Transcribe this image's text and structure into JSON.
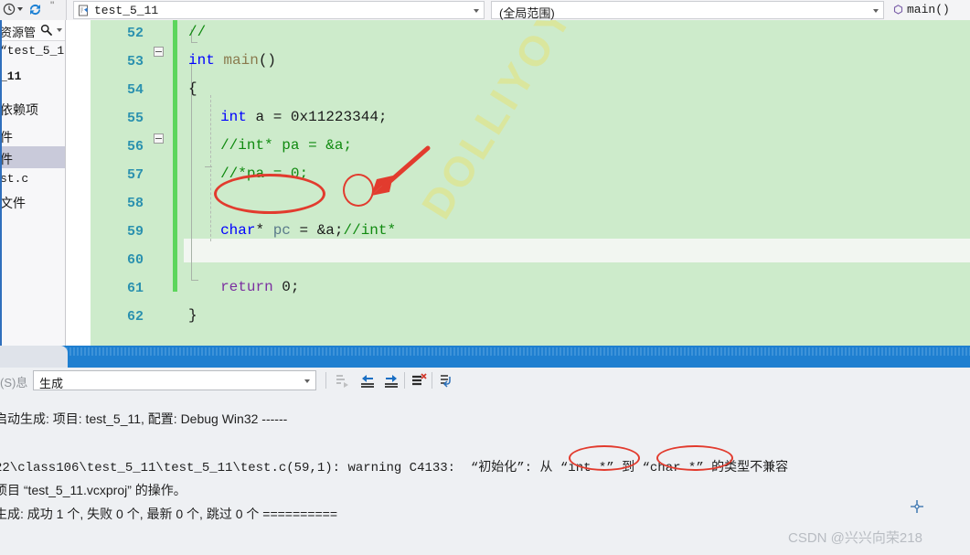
{
  "topbar": {
    "clock_icon": "clock-icon",
    "refresh_icon": "refresh-icon",
    "stray_quote": "\"",
    "file_combo": {
      "value": "test_5_11",
      "icon": "file-c-icon"
    },
    "scope_combo": {
      "value": "(全局范围)"
    },
    "member_combo": {
      "value": "main()",
      "icon": "method-icon"
    }
  },
  "solution_explorer": {
    "search_label": "资源管",
    "search_icon": "search-icon",
    "dropdown_icon": "chevron-down-icon",
    "items": [
      {
        "label": "“test_5_1",
        "style": "mono"
      },
      {
        "label": "_11",
        "style": "bold"
      },
      {
        "label": "依赖项",
        "style": "normal"
      },
      {
        "label": "件",
        "style": "normal"
      },
      {
        "label": "件",
        "style": "normal",
        "selected": true
      },
      {
        "label": "st.c",
        "style": "mono"
      },
      {
        "label": "文件",
        "style": "normal"
      }
    ]
  },
  "editor": {
    "watermark": "DOLLIYOY",
    "lines": [
      {
        "number": "52",
        "indent": 0,
        "tokens": [
          {
            "t": "//",
            "c": "cmt"
          }
        ]
      },
      {
        "number": "53",
        "indent": 0,
        "tokens": [
          {
            "t": "int",
            "c": "kw"
          },
          {
            "t": " ",
            "c": "num"
          },
          {
            "t": "main",
            "c": "fn"
          },
          {
            "t": "()",
            "c": "num"
          }
        ]
      },
      {
        "number": "54",
        "indent": 0,
        "tokens": [
          {
            "t": "{",
            "c": "num"
          }
        ]
      },
      {
        "number": "55",
        "indent": 1,
        "tokens": [
          {
            "t": "int",
            "c": "kw"
          },
          {
            "t": " a = 0x11223344;",
            "c": "num"
          }
        ]
      },
      {
        "number": "56",
        "indent": 1,
        "tokens": [
          {
            "t": "//int* pa = &a;",
            "c": "cmt"
          }
        ]
      },
      {
        "number": "57",
        "indent": 1,
        "tokens": [
          {
            "t": "//*pa = 0;",
            "c": "cmt"
          }
        ]
      },
      {
        "number": "58",
        "indent": 1,
        "tokens": []
      },
      {
        "number": "59",
        "indent": 1,
        "tokens": [
          {
            "t": "char",
            "c": "kw"
          },
          {
            "t": "* ",
            "c": "num"
          },
          {
            "t": "pc",
            "c": "var"
          },
          {
            "t": " = &a;",
            "c": "num"
          },
          {
            "t": "//int*",
            "c": "cmt"
          }
        ]
      },
      {
        "number": "60",
        "indent": 1,
        "tokens": []
      },
      {
        "number": "61",
        "indent": 1,
        "tokens": [
          {
            "t": "return",
            "c": "ret"
          },
          {
            "t": " 0;",
            "c": "num"
          }
        ]
      },
      {
        "number": "62",
        "indent": 0,
        "tokens": [
          {
            "t": "}",
            "c": "num"
          }
        ]
      }
    ]
  },
  "output": {
    "toolbar": {
      "left_label": "(S)息",
      "filter_value": "生成",
      "buttons": [
        {
          "name": "jump-to-source-button",
          "icon": "list-arrow-icon",
          "disabled": true
        },
        {
          "name": "previous-message-button",
          "icon": "arrow-left-list-icon"
        },
        {
          "name": "next-message-button",
          "icon": "arrow-right-list-icon"
        },
        {
          "name": "clear-pane-button",
          "icon": "clear-list-icon"
        },
        {
          "name": "toggle-word-wrap-button",
          "icon": "word-wrap-icon"
        }
      ]
    },
    "lines": [
      {
        "text": "启动生成: 项目: test_5_11, 配置: Debug Win32 ------",
        "cjk": true
      },
      {
        "text": "22\\class106\\test_5_11\\test_5_11\\test.c(59,1): warning C4133:  “初始化”: 从 “int *” 到 “char *” 的类型不兼容",
        "cjk": false
      },
      {
        "text": "项目 “test_5_11.vcxproj” 的操作。",
        "cjk": true
      },
      {
        "text": "生成: 成功 1 个, 失败 0 个, 最新 0 个, 跳过 0 个 ==========",
        "cjk": true
      }
    ]
  },
  "annotations": {
    "ellipse_declaration": "char* pc",
    "ellipse_address_of": "&a",
    "ellipse_int_star": "“int *”",
    "ellipse_char_star": "“char *”",
    "arrow_target": "&a",
    "color": "#e23b2e"
  },
  "watermark": {
    "csdn": "CSDN @兴兴向荣218"
  }
}
